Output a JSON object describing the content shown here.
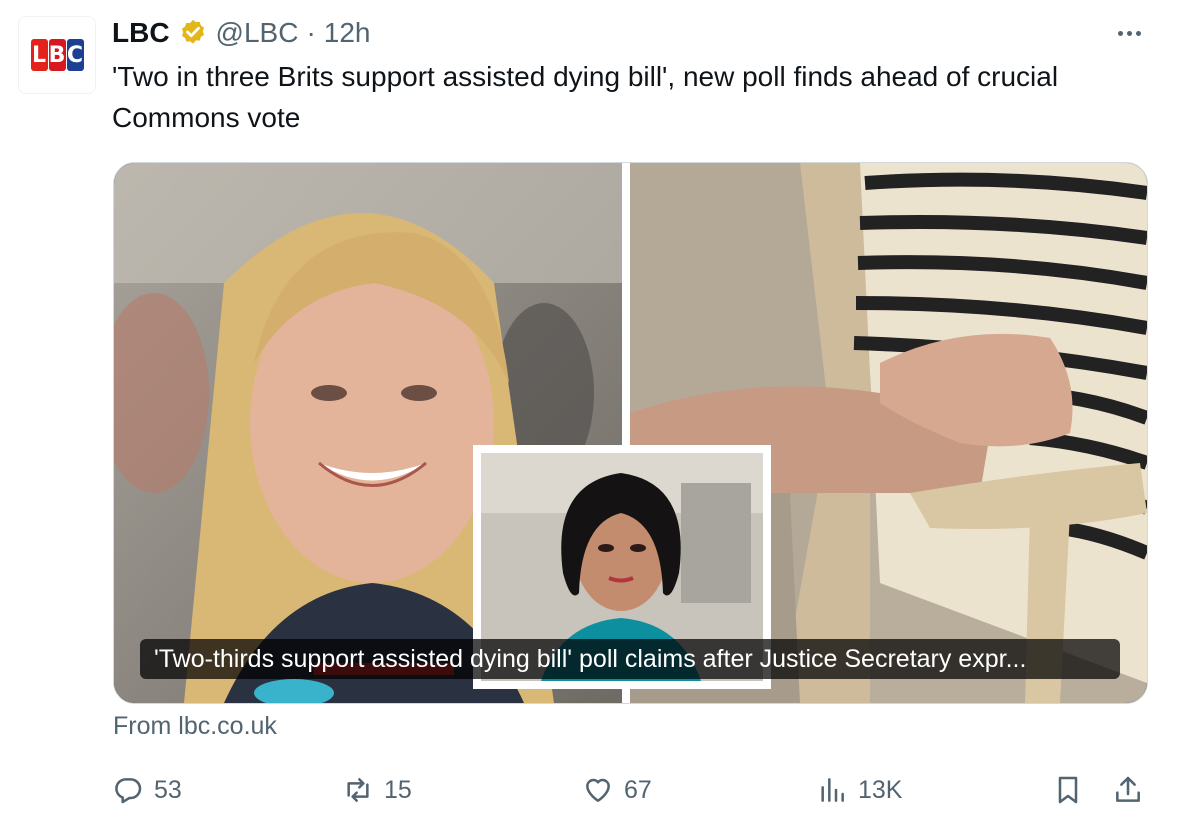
{
  "tweet": {
    "author_name": "LBC",
    "handle": "@LBC",
    "separator": "·",
    "time": "12h",
    "logo_letters": [
      "L",
      "B",
      "C"
    ],
    "text": "'Two in three Brits support assisted dying bill', new poll finds ahead of crucial Commons vote"
  },
  "card": {
    "caption": "'Two-thirds support assisted dying bill' poll claims after Justice Secretary expr...",
    "source": "From lbc.co.uk"
  },
  "actions": {
    "replies": "53",
    "reposts": "15",
    "likes": "67",
    "views": "13K"
  },
  "colors": {
    "text": "#0f1419",
    "secondary": "#536471",
    "verified_gold": "#e2b719",
    "logo_red": "#e3221c",
    "logo_blue": "#1c3f94"
  },
  "icons": {
    "verified": "verified-badge-icon",
    "more": "more-icon",
    "reply": "reply-icon",
    "repost": "repost-icon",
    "like": "heart-icon",
    "views": "views-icon",
    "bookmark": "bookmark-icon",
    "share": "share-icon"
  }
}
